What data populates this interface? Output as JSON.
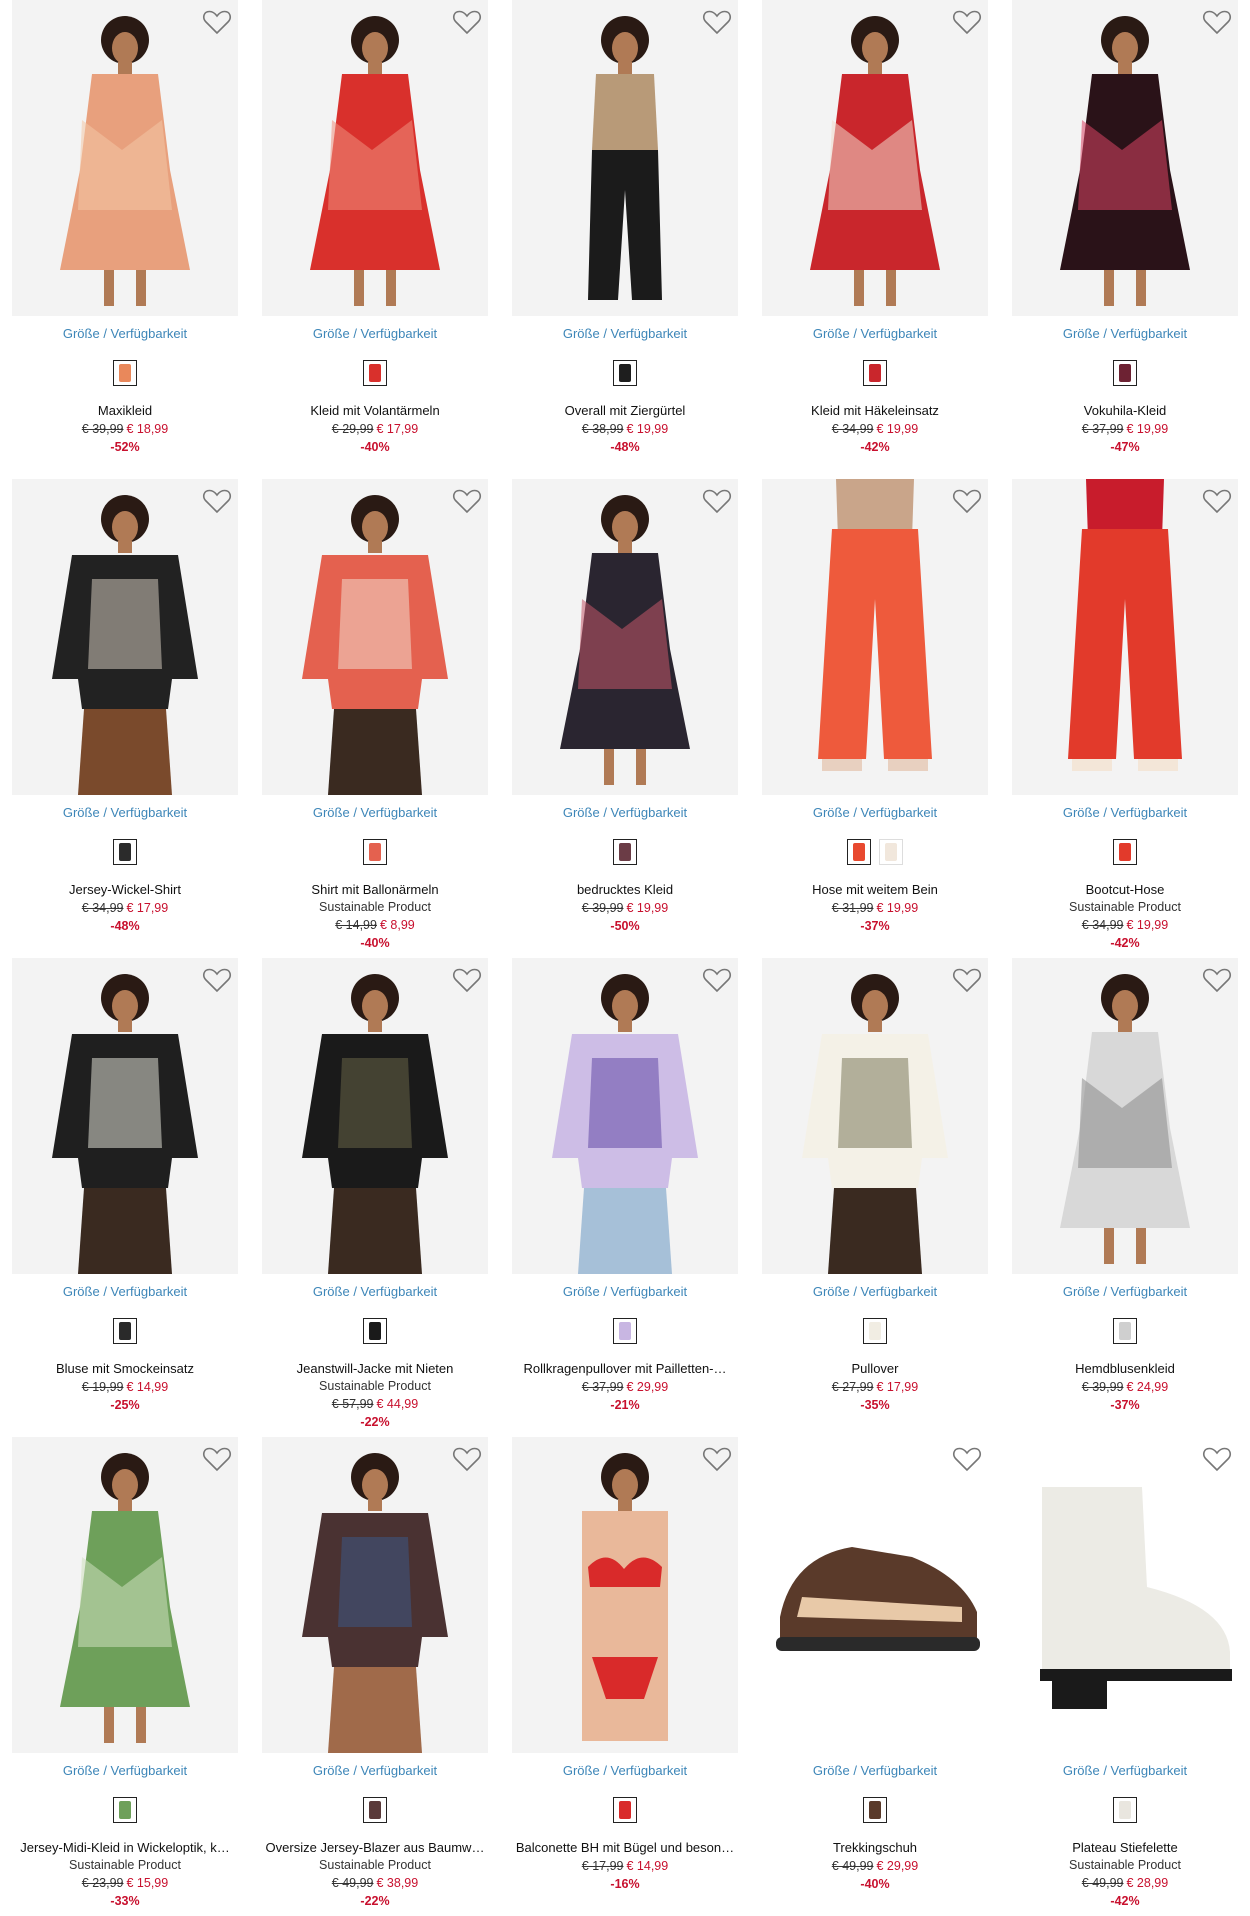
{
  "colors": {
    "link": "#3d86b8",
    "sale": "#c8102e",
    "text": "#111111",
    "imageBg": "#f3f3f3"
  },
  "size_link_label": "Größe / Verfügbarkeit",
  "wishlist_icon": "heart-outline-icon",
  "products": [
    {
      "name": "Maxikleid",
      "sustainable": "",
      "old_price": "€ 39,99",
      "new_price": "€ 18,99",
      "discount": "-52%",
      "swatches": [
        "#e9885b"
      ],
      "palette": [
        "#e8a07d",
        "#f2c7a5",
        "#2e2e2e"
      ],
      "kind": "dress"
    },
    {
      "name": "Kleid mit Volantärmeln",
      "sustainable": "",
      "old_price": "€ 29,99",
      "new_price": "€ 17,99",
      "discount": "-40%",
      "swatches": [
        "#d9302c"
      ],
      "palette": [
        "#d9302c",
        "#ef8f7d",
        "#5a2a1c"
      ],
      "kind": "dress"
    },
    {
      "name": "Overall mit Ziergürtel",
      "sustainable": "",
      "old_price": "€ 38,99",
      "new_price": "€ 19,99",
      "discount": "-48%",
      "swatches": [
        "#1e1e1e"
      ],
      "palette": [
        "#1b1b1b",
        "#b89a78",
        "#3a2a20"
      ],
      "kind": "jumpsuit"
    },
    {
      "name": "Kleid mit Häkeleinsatz",
      "sustainable": "",
      "old_price": "€ 34,99",
      "new_price": "€ 19,99",
      "discount": "-42%",
      "swatches": [
        "#c9262c"
      ],
      "palette": [
        "#c9262c",
        "#f1d9cc",
        "#3a1e16"
      ],
      "kind": "dress"
    },
    {
      "name": "Vokuhila-Kleid",
      "sustainable": "",
      "old_price": "€ 37,99",
      "new_price": "€ 19,99",
      "discount": "-47%",
      "swatches": [
        "#6d2233"
      ],
      "palette": [
        "#2a1218",
        "#d94464",
        "#3a2a20"
      ],
      "kind": "dress"
    },
    {
      "name": "Jersey-Wickel-Shirt",
      "sustainable": "",
      "old_price": "€ 34,99",
      "new_price": "€ 17,99",
      "discount": "-48%",
      "swatches": [
        "#2b2b2b"
      ],
      "palette": [
        "#222222",
        "#e0d6c8",
        "#7a4a2c"
      ],
      "kind": "top"
    },
    {
      "name": "Shirt mit Ballonärmeln",
      "sustainable": "Sustainable Product",
      "old_price": "€ 14,99",
      "new_price": "€ 8,99",
      "discount": "-40%",
      "swatches": [
        "#e4614f"
      ],
      "palette": [
        "#e4614f",
        "#f3e6d8",
        "#3a2a20"
      ],
      "kind": "top"
    },
    {
      "name": "bedrucktes Kleid",
      "sustainable": "",
      "old_price": "€ 39,99",
      "new_price": "€ 19,99",
      "discount": "-50%",
      "swatches": [
        "#6b3c46"
      ],
      "palette": [
        "#2a2530",
        "#c2576a",
        "#3a2a20"
      ],
      "kind": "dress"
    },
    {
      "name": "Hose mit weitem Bein",
      "sustainable": "",
      "old_price": "€ 31,99",
      "new_price": "€ 19,99",
      "discount": "-37%",
      "swatches": [
        "#e8492f",
        "#f1e7dc"
      ],
      "palette": [
        "#ee5a3c",
        "#e8d0c0",
        "#c9a58a"
      ],
      "kind": "pants"
    },
    {
      "name": "Bootcut-Hose",
      "sustainable": "Sustainable Product",
      "old_price": "€ 34,99",
      "new_price": "€ 19,99",
      "discount": "-42%",
      "swatches": [
        "#e23a2b"
      ],
      "palette": [
        "#e23a2b",
        "#f3e6d8",
        "#c81c2c"
      ],
      "kind": "pants"
    },
    {
      "name": "Bluse mit Smockeinsatz",
      "sustainable": "",
      "old_price": "€ 19,99",
      "new_price": "€ 14,99",
      "discount": "-25%",
      "swatches": [
        "#2a2a2a"
      ],
      "palette": [
        "#1f1f1f",
        "#f0efe4",
        "#3a2a20"
      ],
      "kind": "top"
    },
    {
      "name": "Jeanstwill-Jacke mit Nieten",
      "sustainable": "Sustainable Product",
      "old_price": "€ 57,99",
      "new_price": "€ 44,99",
      "discount": "-22%",
      "swatches": [
        "#1a1a1a"
      ],
      "palette": [
        "#1a1a1a",
        "#6e6a4a",
        "#3a2a20"
      ],
      "kind": "top"
    },
    {
      "name": "Rollkragenpullover mit Pailletten-…",
      "sustainable": "",
      "old_price": "€ 37,99",
      "new_price": "€ 29,99",
      "discount": "-21%",
      "swatches": [
        "#c8b6e2"
      ],
      "palette": [
        "#cdbde6",
        "#5a3fa0",
        "#a6c0d8"
      ],
      "kind": "top"
    },
    {
      "name": "Pullover",
      "sustainable": "",
      "old_price": "€ 27,99",
      "new_price": "€ 17,99",
      "discount": "-35%",
      "swatches": [
        "#f1ede3"
      ],
      "palette": [
        "#f4f1e7",
        "#6f6e4e",
        "#3a2a20"
      ],
      "kind": "top"
    },
    {
      "name": "Hemdblusenkleid",
      "sustainable": "",
      "old_price": "€ 39,99",
      "new_price": "€ 24,99",
      "discount": "-37%",
      "swatches": [
        "#cfcfcf"
      ],
      "palette": [
        "#d8d8d8",
        "#8a8a8a",
        "#7a4a2c"
      ],
      "kind": "dress"
    },
    {
      "name": "Jersey-Midi-Kleid in Wickeloptik, k…",
      "sustainable": "Sustainable Product",
      "old_price": "€ 23,99",
      "new_price": "€ 15,99",
      "discount": "-33%",
      "swatches": [
        "#6ea05a"
      ],
      "palette": [
        "#6ea05a",
        "#cfe0bf",
        "#8a5a3a"
      ],
      "kind": "dress"
    },
    {
      "name": "Oversize Jersey-Blazer aus Baumw…",
      "sustainable": "Sustainable Product",
      "old_price": "€ 49,99",
      "new_price": "€ 38,99",
      "discount": "-22%",
      "swatches": [
        "#5a3a3a"
      ],
      "palette": [
        "#4a3232",
        "#3a5a8c",
        "#a06a4a"
      ],
      "kind": "top"
    },
    {
      "name": "Balconette BH mit Bügel und beson…",
      "sustainable": "",
      "old_price": "€ 17,99",
      "new_price": "€ 14,99",
      "discount": "-16%",
      "swatches": [
        "#d92a2a"
      ],
      "palette": [
        "#d92a2a",
        "#e9b89a",
        "#7a4a2c"
      ],
      "kind": "lingerie"
    },
    {
      "name": "Trekkingschuh",
      "sustainable": "",
      "old_price": "€ 49,99",
      "new_price": "€ 29,99",
      "discount": "-40%",
      "swatches": [
        "#5a3a2a"
      ],
      "palette": [
        "#5a3a2a",
        "#e8c9a8",
        "#2a2a2a"
      ],
      "kind": "shoe"
    },
    {
      "name": "Plateau Stiefelette",
      "sustainable": "Sustainable Product",
      "old_price": "€ 49,99",
      "new_price": "€ 28,99",
      "discount": "-42%",
      "swatches": [
        "#e9e6df"
      ],
      "palette": [
        "#ecebe5",
        "#1a1a1a",
        "#bdbab2"
      ],
      "kind": "boot"
    }
  ]
}
